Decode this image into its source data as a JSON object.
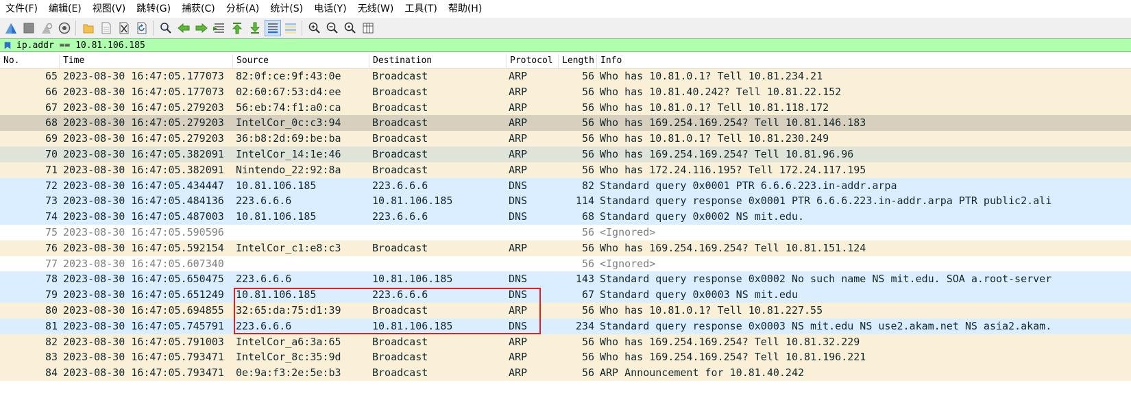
{
  "menu": [
    "文件(F)",
    "编辑(E)",
    "视图(V)",
    "跳转(G)",
    "捕获(C)",
    "分析(A)",
    "统计(S)",
    "电话(Y)",
    "无线(W)",
    "工具(T)",
    "帮助(H)"
  ],
  "toolbar": {
    "icons": [
      "shark-fin-start-icon",
      "stop-icon",
      "restart-icon",
      "capture-options-icon",
      "open-folder-icon",
      "save-file-icon",
      "close-file-icon",
      "reload-icon",
      "find-packet-icon",
      "go-back-icon",
      "go-forward-icon",
      "go-to-packet-icon",
      "go-first-icon",
      "go-last-icon",
      "auto-scroll-icon",
      "colorize-icon",
      "zoom-in-icon",
      "zoom-out-icon",
      "zoom-normal-icon",
      "resize-columns-icon"
    ]
  },
  "filter": {
    "value": "ip.addr == 10.81.106.185"
  },
  "columns": [
    "No.",
    "Time",
    "Source",
    "Destination",
    "Protocol",
    "Length",
    "Info"
  ],
  "packets": [
    {
      "no": "65",
      "time": "2023-08-30 16:47:05.177073",
      "src": "82:0f:ce:9f:43:0e",
      "dst": "Broadcast",
      "proto": "ARP",
      "len": "56",
      "info": "Who has 10.81.0.1? Tell 10.81.234.21",
      "kind": "arp"
    },
    {
      "no": "66",
      "time": "2023-08-30 16:47:05.177073",
      "src": "02:60:67:53:d4:ee",
      "dst": "Broadcast",
      "proto": "ARP",
      "len": "56",
      "info": "Who has 10.81.40.242? Tell 10.81.22.152",
      "kind": "arp"
    },
    {
      "no": "67",
      "time": "2023-08-30 16:47:05.279203",
      "src": "56:eb:74:f1:a0:ca",
      "dst": "Broadcast",
      "proto": "ARP",
      "len": "56",
      "info": "Who has 10.81.0.1? Tell 10.81.118.172",
      "kind": "arp"
    },
    {
      "no": "68",
      "time": "2023-08-30 16:47:05.279203",
      "src": "IntelCor_0c:c3:94",
      "dst": "Broadcast",
      "proto": "ARP",
      "len": "56",
      "info": "Who has 169.254.169.254? Tell 10.81.146.183",
      "kind": "sel"
    },
    {
      "no": "69",
      "time": "2023-08-30 16:47:05.279203",
      "src": "36:b8:2d:69:be:ba",
      "dst": "Broadcast",
      "proto": "ARP",
      "len": "56",
      "info": "Who has 10.81.0.1? Tell 10.81.230.249",
      "kind": "arp"
    },
    {
      "no": "70",
      "time": "2023-08-30 16:47:05.382091",
      "src": "IntelCor_14:1e:46",
      "dst": "Broadcast",
      "proto": "ARP",
      "len": "56",
      "info": "Who has 169.254.169.254? Tell 10.81.96.96",
      "kind": "alt"
    },
    {
      "no": "71",
      "time": "2023-08-30 16:47:05.382091",
      "src": "Nintendo_22:92:8a",
      "dst": "Broadcast",
      "proto": "ARP",
      "len": "56",
      "info": "Who has 172.24.116.195? Tell 172.24.117.195",
      "kind": "arp"
    },
    {
      "no": "72",
      "time": "2023-08-30 16:47:05.434447",
      "src": "10.81.106.185",
      "dst": "223.6.6.6",
      "proto": "DNS",
      "len": "82",
      "info": "Standard query 0x0001 PTR 6.6.6.223.in-addr.arpa",
      "kind": "dns"
    },
    {
      "no": "73",
      "time": "2023-08-30 16:47:05.484136",
      "src": "223.6.6.6",
      "dst": "10.81.106.185",
      "proto": "DNS",
      "len": "114",
      "info": "Standard query response 0x0001 PTR 6.6.6.223.in-addr.arpa PTR public2.ali",
      "kind": "dns"
    },
    {
      "no": "74",
      "time": "2023-08-30 16:47:05.487003",
      "src": "10.81.106.185",
      "dst": "223.6.6.6",
      "proto": "DNS",
      "len": "68",
      "info": "Standard query 0x0002 NS mit.edu.",
      "kind": "dns"
    },
    {
      "no": "75",
      "time": "2023-08-30 16:47:05.590596",
      "src": "",
      "dst": "",
      "proto": "",
      "len": "56",
      "info": "<Ignored>",
      "kind": "ign"
    },
    {
      "no": "76",
      "time": "2023-08-30 16:47:05.592154",
      "src": "IntelCor_c1:e8:c3",
      "dst": "Broadcast",
      "proto": "ARP",
      "len": "56",
      "info": "Who has 169.254.169.254? Tell 10.81.151.124",
      "kind": "arp"
    },
    {
      "no": "77",
      "time": "2023-08-30 16:47:05.607340",
      "src": "",
      "dst": "",
      "proto": "",
      "len": "56",
      "info": "<Ignored>",
      "kind": "ign"
    },
    {
      "no": "78",
      "time": "2023-08-30 16:47:05.650475",
      "src": "223.6.6.6",
      "dst": "10.81.106.185",
      "proto": "DNS",
      "len": "143",
      "info": "Standard query response 0x0002 No such name NS mit.edu. SOA a.root-server",
      "kind": "dns"
    },
    {
      "no": "79",
      "time": "2023-08-30 16:47:05.651249",
      "src": "10.81.106.185",
      "dst": "223.6.6.6",
      "proto": "DNS",
      "len": "67",
      "info": "Standard query 0x0003 NS mit.edu",
      "kind": "dns"
    },
    {
      "no": "80",
      "time": "2023-08-30 16:47:05.694855",
      "src": "32:65:da:75:d1:39",
      "dst": "Broadcast",
      "proto": "ARP",
      "len": "56",
      "info": "Who has 10.81.0.1? Tell 10.81.227.55",
      "kind": "arp"
    },
    {
      "no": "81",
      "time": "2023-08-30 16:47:05.745791",
      "src": "223.6.6.6",
      "dst": "10.81.106.185",
      "proto": "DNS",
      "len": "234",
      "info": "Standard query response 0x0003 NS mit.edu NS use2.akam.net NS asia2.akam.",
      "kind": "dns"
    },
    {
      "no": "82",
      "time": "2023-08-30 16:47:05.791003",
      "src": "IntelCor_a6:3a:65",
      "dst": "Broadcast",
      "proto": "ARP",
      "len": "56",
      "info": "Who has 169.254.169.254? Tell 10.81.32.229",
      "kind": "arp"
    },
    {
      "no": "83",
      "time": "2023-08-30 16:47:05.793471",
      "src": "IntelCor_8c:35:9d",
      "dst": "Broadcast",
      "proto": "ARP",
      "len": "56",
      "info": "Who has 169.254.169.254? Tell 10.81.196.221",
      "kind": "arp"
    },
    {
      "no": "84",
      "time": "2023-08-30 16:47:05.793471",
      "src": "0e:9a:f3:2e:5e:b3",
      "dst": "Broadcast",
      "proto": "ARP",
      "len": "56",
      "info": "ARP Announcement for 10.81.40.242",
      "kind": "arp"
    }
  ],
  "colors": {
    "arp_row": "#faf0d7",
    "dns_row": "#daeeff",
    "selected_row": "#d8d0be",
    "filter_valid": "#afffaf",
    "annotation_box": "#e02020"
  }
}
